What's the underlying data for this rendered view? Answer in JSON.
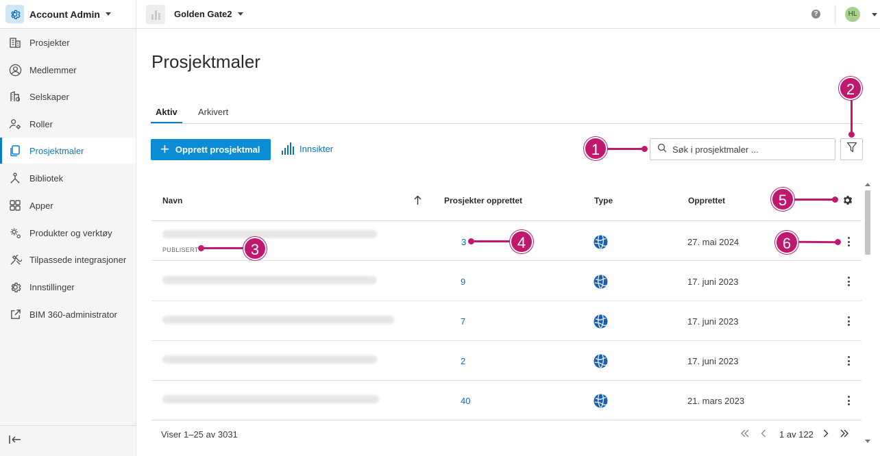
{
  "topbar": {
    "account_name": "Account Admin",
    "project_name": "Golden Gate2",
    "help_label": "?",
    "avatar_initials": "HL"
  },
  "sidebar": {
    "items": [
      {
        "label": "Prosjekter",
        "icon": "building-icon"
      },
      {
        "label": "Medlemmer",
        "icon": "person-circle-icon"
      },
      {
        "label": "Selskaper",
        "icon": "company-icon"
      },
      {
        "label": "Roller",
        "icon": "role-gear-icon"
      },
      {
        "label": "Prosjektmaler",
        "icon": "template-copy-icon"
      },
      {
        "label": "Bibliotek",
        "icon": "library-nodes-icon"
      },
      {
        "label": "Apper",
        "icon": "apps-grid-icon"
      },
      {
        "label": "Produkter og verktøy",
        "icon": "products-gear-icon"
      },
      {
        "label": "Tilpassede integrasjoner",
        "icon": "integration-tools-icon"
      },
      {
        "label": "Innstillinger",
        "icon": "settings-gear-icon"
      },
      {
        "label": "BIM 360-administrator",
        "icon": "external-link-icon"
      }
    ],
    "active_index": 4
  },
  "main": {
    "title": "Prosjektmaler",
    "tabs": [
      {
        "label": "Aktiv"
      },
      {
        "label": "Arkivert"
      }
    ],
    "create_button": "Opprett prosjektmal",
    "insights_link": "Innsikter",
    "search_placeholder": "Søk i prosjektmaler ..."
  },
  "table": {
    "columns": [
      "Navn",
      "Prosjekter opprettet",
      "Type",
      "Opprettet"
    ],
    "sort_column": "Navn",
    "sort_direction": "ascending",
    "rows": [
      {
        "status": "PUBLISERT",
        "projects_created": "3",
        "created": "27. mai 2024"
      },
      {
        "status": "",
        "projects_created": "9",
        "created": "17. juni 2023"
      },
      {
        "status": "",
        "projects_created": "7",
        "created": "17. juni 2023"
      },
      {
        "status": "",
        "projects_created": "2",
        "created": "17. juni 2023"
      },
      {
        "status": "",
        "projects_created": "40",
        "created": "21. mars 2023"
      }
    ]
  },
  "footer": {
    "showing": "Viser 1–25 av 3031",
    "page_label": "1 av 122"
  },
  "callouts": [
    "1",
    "2",
    "3",
    "4",
    "5",
    "6"
  ],
  "colors": {
    "accent": "#0b8dd6",
    "link": "#0b6fb8",
    "callout": "#c0186f",
    "globe": "#1a5fb4"
  }
}
